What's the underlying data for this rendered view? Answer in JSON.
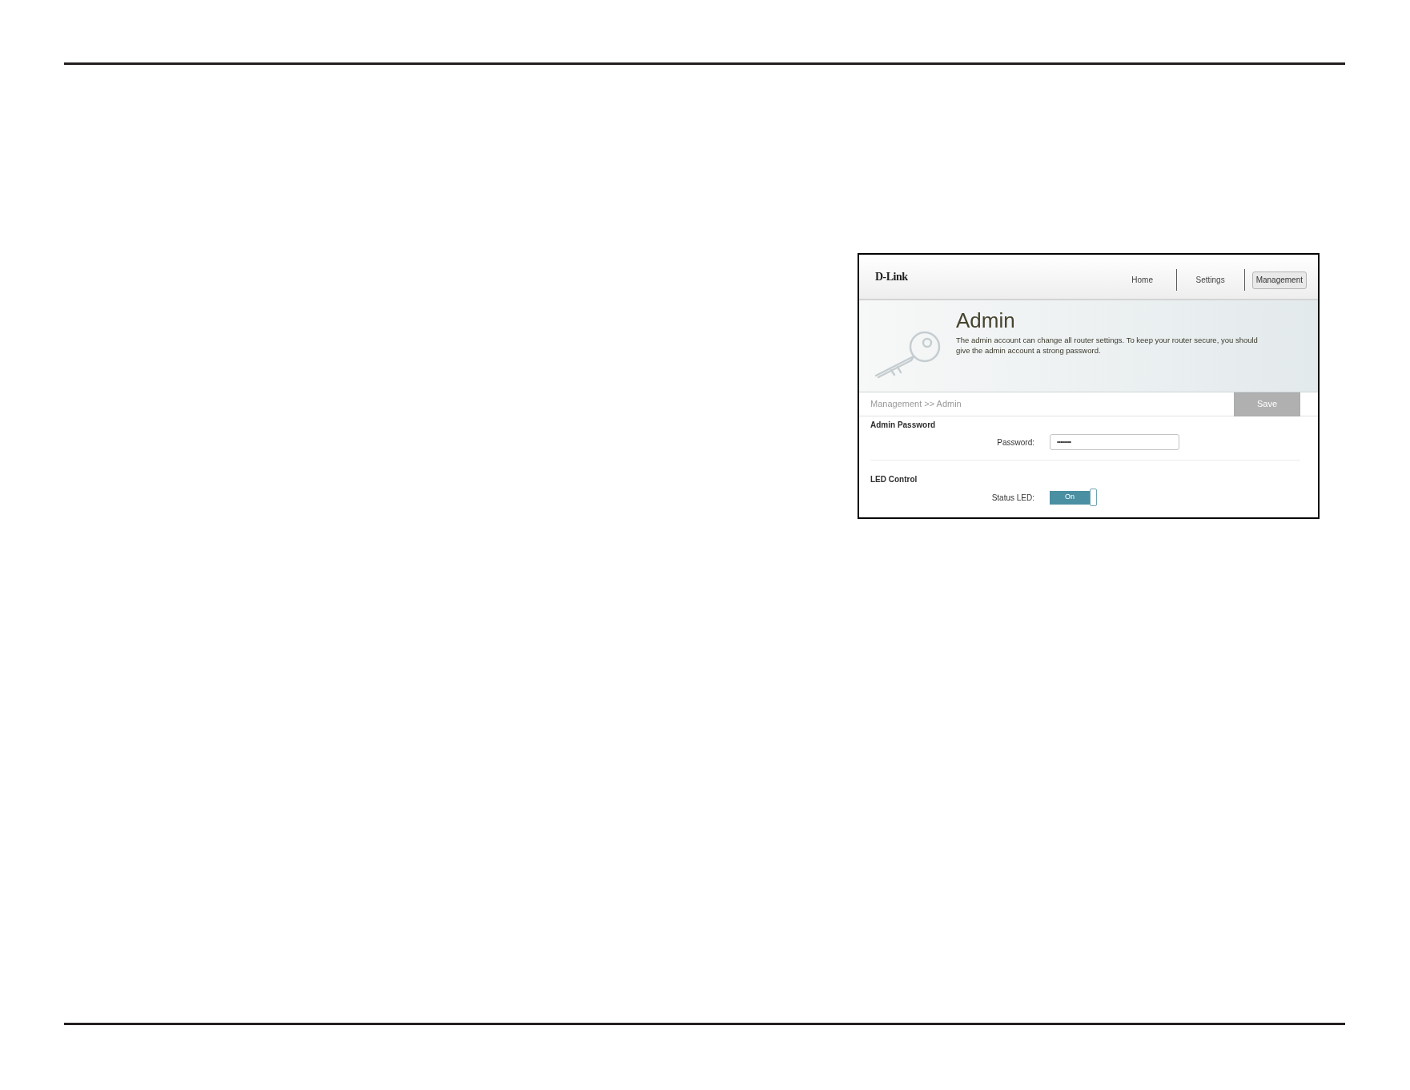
{
  "screenshot": {
    "header": {
      "logo": "D-Link",
      "nav": [
        {
          "label": "Home",
          "selected": false
        },
        {
          "label": "Settings",
          "selected": false
        },
        {
          "label": "Management",
          "selected": true
        }
      ]
    },
    "banner": {
      "title": "Admin",
      "description": "The admin account can change all router settings. To keep your router secure, you should give the admin account a strong password."
    },
    "toolbar": {
      "breadcrumb": "Management >> Admin",
      "save_button": {
        "label": "Save",
        "disabled": true
      }
    },
    "sections": [
      {
        "heading": "Admin Password",
        "fields": [
          {
            "kind": "password",
            "label": "Password:",
            "value": "•••••••••"
          }
        ]
      },
      {
        "heading": "LED Control",
        "fields": [
          {
            "kind": "toggle",
            "label": "Status LED:",
            "on": true,
            "state_label": "On"
          }
        ]
      }
    ]
  }
}
